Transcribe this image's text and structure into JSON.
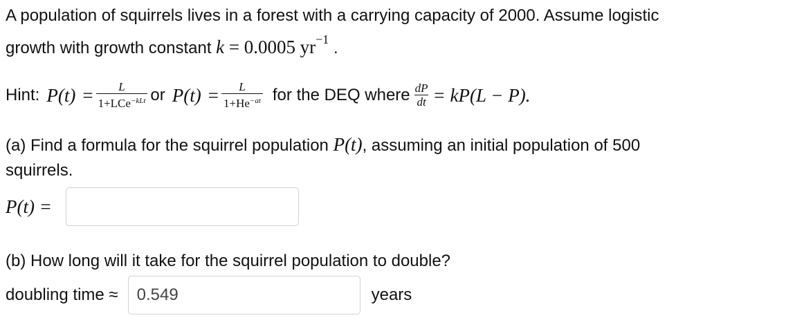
{
  "problem": {
    "intro_line1": "A population of squirrels lives in a forest with a carrying capacity of 2000. Assume logistic",
    "intro_line2_text": "growth with growth constant",
    "k_symbol": "k",
    "equals": "=",
    "k_value": "0.0005",
    "k_unit": "yr",
    "k_exp": "−1",
    "period": "."
  },
  "hint": {
    "label": "Hint:",
    "lhs1": "P(t)",
    "eq": "=",
    "frac1_num": "L",
    "frac1_den": "1+LCe",
    "frac1_exp": "−kLt",
    "or": "or",
    "lhs2": "P(t)",
    "frac2_num": "L",
    "frac2_den": "1+He",
    "frac2_exp": "−at",
    "deq_text": "for the DEQ where",
    "deriv_num": "dP",
    "deriv_den": "dt",
    "rhs": "= kP(L − P)."
  },
  "part_a": {
    "question_line1": "(a) Find a formula for the squirrel population",
    "question_func": "P(t)",
    "question_line1_end": ", assuming an initial population of 500",
    "question_line2": "squirrels.",
    "answer_label": "P(t) =",
    "answer_value": ""
  },
  "part_b": {
    "question": "(b) How long will it take for the squirrel population to double?",
    "answer_label": "doubling time ≈",
    "answer_value": "0.549",
    "unit": "years"
  }
}
